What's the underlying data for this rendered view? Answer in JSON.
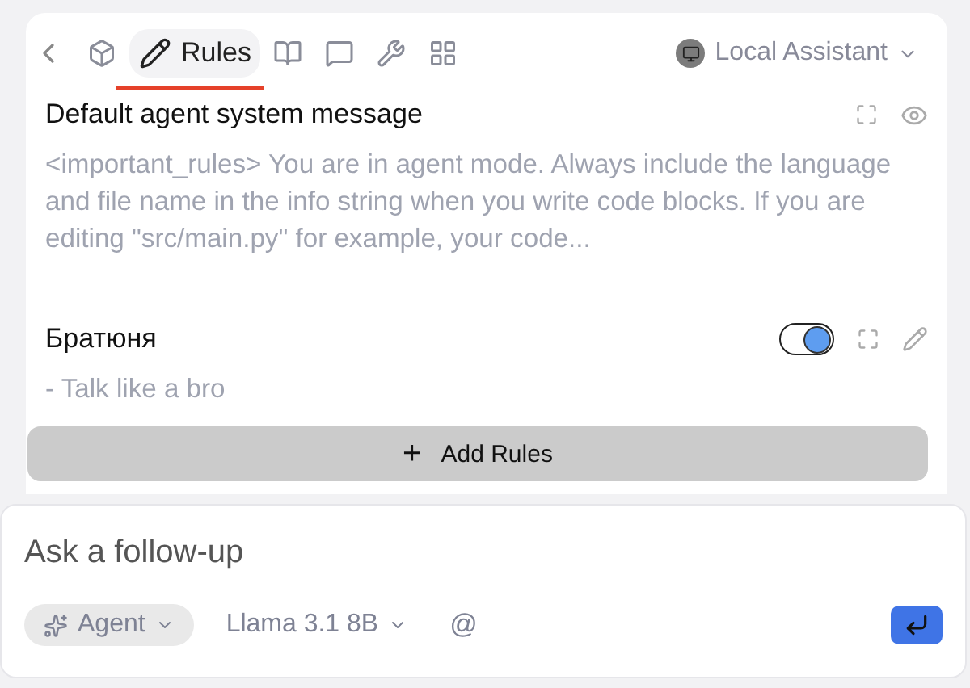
{
  "toolbar": {
    "tabs": [
      {
        "kind": "models",
        "selected": false
      },
      {
        "kind": "rules",
        "label": "Rules",
        "selected": true
      },
      {
        "kind": "docs",
        "selected": false
      },
      {
        "kind": "prompts",
        "selected": false
      },
      {
        "kind": "tools",
        "selected": false
      },
      {
        "kind": "mcp",
        "selected": false
      }
    ],
    "assistant": "Local Assistant"
  },
  "rules": [
    {
      "kind": "builtin",
      "title": "Default agent system message",
      "description": "<important_rules> You are in agent mode. Always include the language and file name in the info string when you write code blocks. If you are editing \"src/main.py\" for example, your code..."
    },
    {
      "kind": "custom",
      "title": "Братюня",
      "description": "- Talk like a bro",
      "on": true
    }
  ],
  "add_button": {
    "icon": "+",
    "label": "Add Rules"
  },
  "composer": {
    "placeholder": "Ask a follow-up",
    "mode": "Agent",
    "model": "Llama 3.1 8B",
    "mention": "@"
  }
}
